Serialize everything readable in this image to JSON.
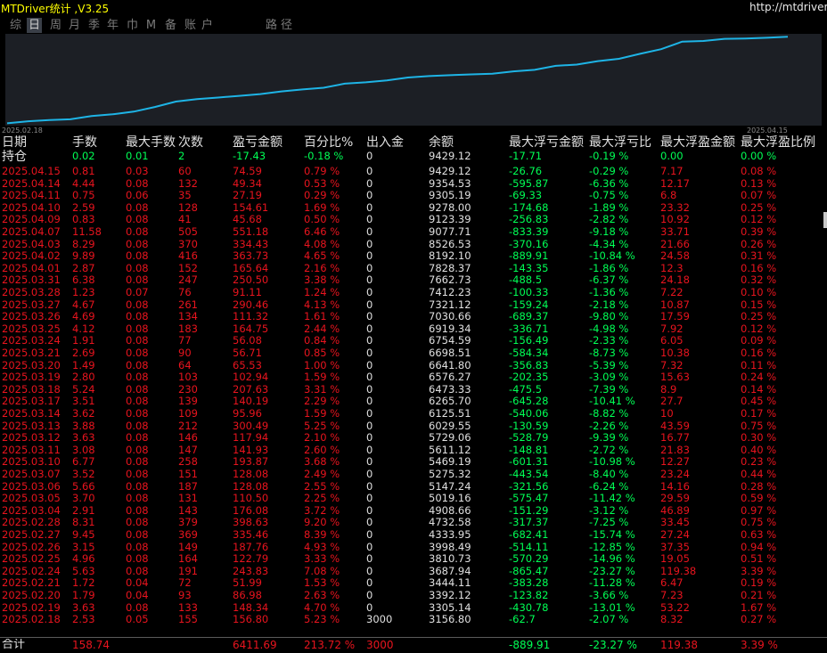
{
  "titlebar": {
    "title": "MTDriver统计 ,V3.25",
    "url": "http://mtdriver.c"
  },
  "tabs": [
    {
      "label": "综",
      "active": false
    },
    {
      "label": "日",
      "active": true
    },
    {
      "label": "周",
      "active": false
    },
    {
      "label": "月",
      "active": false
    },
    {
      "label": "季",
      "active": false
    },
    {
      "label": "年",
      "active": false
    },
    {
      "label": "巾",
      "active": false
    },
    {
      "label": "M",
      "active": false
    },
    {
      "label": "备",
      "active": false
    },
    {
      "label": "账",
      "active": false
    },
    {
      "label": "户",
      "active": false
    },
    {
      "label": "路",
      "active": false
    },
    {
      "label": "径",
      "active": false
    }
  ],
  "chart_data": {
    "type": "line",
    "x_start_label": "2025.02.18",
    "x_end_label": "2025.04.15",
    "line_color": "#1eb4e6",
    "x": [
      "2025.02.18",
      "2025.02.19",
      "2025.02.20",
      "2025.02.21",
      "2025.02.24",
      "2025.02.25",
      "2025.02.26",
      "2025.02.27",
      "2025.02.28",
      "2025.03.04",
      "2025.03.05",
      "2025.03.06",
      "2025.03.07",
      "2025.03.10",
      "2025.03.11",
      "2025.03.12",
      "2025.03.13",
      "2025.03.14",
      "2025.03.17",
      "2025.03.18",
      "2025.03.19",
      "2025.03.20",
      "2025.03.21",
      "2025.03.24",
      "2025.03.25",
      "2025.03.26",
      "2025.03.27",
      "2025.03.28",
      "2025.03.31",
      "2025.04.01",
      "2025.04.02",
      "2025.04.03",
      "2025.04.07",
      "2025.04.09",
      "2025.04.10",
      "2025.04.11",
      "2025.04.14",
      "2025.04.15"
    ],
    "values": [
      3156.8,
      3305.14,
      3392.12,
      3444.11,
      3687.94,
      3810.73,
      3998.49,
      4333.95,
      4732.58,
      4908.66,
      5019.16,
      5147.24,
      5275.32,
      5469.19,
      5611.12,
      5729.06,
      6029.55,
      6125.51,
      6265.7,
      6473.33,
      6576.27,
      6641.8,
      6698.51,
      6754.59,
      6919.34,
      7030.66,
      7321.12,
      7412.23,
      7662.73,
      7828.37,
      8192.1,
      8526.53,
      9077.71,
      9123.39,
      9278.0,
      9305.19,
      9354.53,
      9429.12
    ]
  },
  "columns": [
    "日期",
    "手数",
    "最大手数",
    "次数",
    "盈亏金额",
    "百分比%",
    "出入金",
    "余额",
    "最大浮亏金额",
    "最大浮亏比",
    "最大浮盈金额",
    "最大浮盈比例"
  ],
  "current": {
    "date": "持仓",
    "lots": "0.02",
    "max_lots": "0.01",
    "count": "2",
    "pnl": "-17.43",
    "pct": "-0.18 %",
    "inout": "0",
    "balance": "9429.12",
    "max_loss": "-17.71",
    "max_loss_pct": "-0.19 %",
    "max_profit": "0.00",
    "max_profit_pct": "0.00 %"
  },
  "rows": [
    {
      "date": "2025.04.15",
      "lots": "0.81",
      "max_lots": "0.03",
      "count": "60",
      "pnl": "74.59",
      "pct": "0.79 %",
      "inout": "0",
      "balance": "9429.12",
      "max_loss": "-26.76",
      "max_loss_pct": "-0.29 %",
      "max_profit": "7.17",
      "max_profit_pct": "0.08 %"
    },
    {
      "date": "2025.04.14",
      "lots": "4.44",
      "max_lots": "0.08",
      "count": "132",
      "pnl": "49.34",
      "pct": "0.53 %",
      "inout": "0",
      "balance": "9354.53",
      "max_loss": "-595.87",
      "max_loss_pct": "-6.36 %",
      "max_profit": "12.17",
      "max_profit_pct": "0.13 %"
    },
    {
      "date": "2025.04.11",
      "lots": "0.75",
      "max_lots": "0.06",
      "count": "35",
      "pnl": "27.19",
      "pct": "0.29 %",
      "inout": "0",
      "balance": "9305.19",
      "max_loss": "-69.33",
      "max_loss_pct": "-0.75 %",
      "max_profit": "6.8",
      "max_profit_pct": "0.07 %"
    },
    {
      "date": "2025.04.10",
      "lots": "2.59",
      "max_lots": "0.08",
      "count": "128",
      "pnl": "154.61",
      "pct": "1.69 %",
      "inout": "0",
      "balance": "9278.00",
      "max_loss": "-174.68",
      "max_loss_pct": "-1.89 %",
      "max_profit": "23.32",
      "max_profit_pct": "0.25 %"
    },
    {
      "date": "2025.04.09",
      "lots": "0.83",
      "max_lots": "0.08",
      "count": "41",
      "pnl": "45.68",
      "pct": "0.50 %",
      "inout": "0",
      "balance": "9123.39",
      "max_loss": "-256.83",
      "max_loss_pct": "-2.82 %",
      "max_profit": "10.92",
      "max_profit_pct": "0.12 %"
    },
    {
      "date": "2025.04.07",
      "lots": "11.58",
      "max_lots": "0.08",
      "count": "505",
      "pnl": "551.18",
      "pct": "6.46 %",
      "inout": "0",
      "balance": "9077.71",
      "max_loss": "-833.39",
      "max_loss_pct": "-9.18 %",
      "max_profit": "33.71",
      "max_profit_pct": "0.39 %"
    },
    {
      "date": "2025.04.03",
      "lots": "8.29",
      "max_lots": "0.08",
      "count": "370",
      "pnl": "334.43",
      "pct": "4.08 %",
      "inout": "0",
      "balance": "8526.53",
      "max_loss": "-370.16",
      "max_loss_pct": "-4.34 %",
      "max_profit": "21.66",
      "max_profit_pct": "0.26 %"
    },
    {
      "date": "2025.04.02",
      "lots": "9.89",
      "max_lots": "0.08",
      "count": "416",
      "pnl": "363.73",
      "pct": "4.65 %",
      "inout": "0",
      "balance": "8192.10",
      "max_loss": "-889.91",
      "max_loss_pct": "-10.84 %",
      "max_profit": "24.58",
      "max_profit_pct": "0.31 %"
    },
    {
      "date": "2025.04.01",
      "lots": "2.87",
      "max_lots": "0.08",
      "count": "152",
      "pnl": "165.64",
      "pct": "2.16 %",
      "inout": "0",
      "balance": "7828.37",
      "max_loss": "-143.35",
      "max_loss_pct": "-1.86 %",
      "max_profit": "12.3",
      "max_profit_pct": "0.16 %"
    },
    {
      "date": "2025.03.31",
      "lots": "6.38",
      "max_lots": "0.08",
      "count": "247",
      "pnl": "250.50",
      "pct": "3.38 %",
      "inout": "0",
      "balance": "7662.73",
      "max_loss": "-488.5",
      "max_loss_pct": "-6.37 %",
      "max_profit": "24.18",
      "max_profit_pct": "0.32 %"
    },
    {
      "date": "2025.03.28",
      "lots": "1.23",
      "max_lots": "0.07",
      "count": "76",
      "pnl": "91.11",
      "pct": "1.24 %",
      "inout": "0",
      "balance": "7412.23",
      "max_loss": "-100.33",
      "max_loss_pct": "-1.36 %",
      "max_profit": "7.22",
      "max_profit_pct": "0.10 %"
    },
    {
      "date": "2025.03.27",
      "lots": "4.67",
      "max_lots": "0.08",
      "count": "261",
      "pnl": "290.46",
      "pct": "4.13 %",
      "inout": "0",
      "balance": "7321.12",
      "max_loss": "-159.24",
      "max_loss_pct": "-2.18 %",
      "max_profit": "10.87",
      "max_profit_pct": "0.15 %"
    },
    {
      "date": "2025.03.26",
      "lots": "4.69",
      "max_lots": "0.08",
      "count": "134",
      "pnl": "111.32",
      "pct": "1.61 %",
      "inout": "0",
      "balance": "7030.66",
      "max_loss": "-689.37",
      "max_loss_pct": "-9.80 %",
      "max_profit": "17.59",
      "max_profit_pct": "0.25 %"
    },
    {
      "date": "2025.03.25",
      "lots": "4.12",
      "max_lots": "0.08",
      "count": "183",
      "pnl": "164.75",
      "pct": "2.44 %",
      "inout": "0",
      "balance": "6919.34",
      "max_loss": "-336.71",
      "max_loss_pct": "-4.98 %",
      "max_profit": "7.92",
      "max_profit_pct": "0.12 %"
    },
    {
      "date": "2025.03.24",
      "lots": "1.91",
      "max_lots": "0.08",
      "count": "77",
      "pnl": "56.08",
      "pct": "0.84 %",
      "inout": "0",
      "balance": "6754.59",
      "max_loss": "-156.49",
      "max_loss_pct": "-2.33 %",
      "max_profit": "6.05",
      "max_profit_pct": "0.09 %"
    },
    {
      "date": "2025.03.21",
      "lots": "2.69",
      "max_lots": "0.08",
      "count": "90",
      "pnl": "56.71",
      "pct": "0.85 %",
      "inout": "0",
      "balance": "6698.51",
      "max_loss": "-584.34",
      "max_loss_pct": "-8.73 %",
      "max_profit": "10.38",
      "max_profit_pct": "0.16 %"
    },
    {
      "date": "2025.03.20",
      "lots": "1.49",
      "max_lots": "0.08",
      "count": "64",
      "pnl": "65.53",
      "pct": "1.00 %",
      "inout": "0",
      "balance": "6641.80",
      "max_loss": "-356.83",
      "max_loss_pct": "-5.39 %",
      "max_profit": "7.32",
      "max_profit_pct": "0.11 %"
    },
    {
      "date": "2025.03.19",
      "lots": "2.80",
      "max_lots": "0.08",
      "count": "103",
      "pnl": "102.94",
      "pct": "1.59 %",
      "inout": "0",
      "balance": "6576.27",
      "max_loss": "-202.35",
      "max_loss_pct": "-3.09 %",
      "max_profit": "15.63",
      "max_profit_pct": "0.24 %"
    },
    {
      "date": "2025.03.18",
      "lots": "5.24",
      "max_lots": "0.08",
      "count": "230",
      "pnl": "207.63",
      "pct": "3.31 %",
      "inout": "0",
      "balance": "6473.33",
      "max_loss": "-475.5",
      "max_loss_pct": "-7.39 %",
      "max_profit": "8.9",
      "max_profit_pct": "0.14 %"
    },
    {
      "date": "2025.03.17",
      "lots": "3.51",
      "max_lots": "0.08",
      "count": "139",
      "pnl": "140.19",
      "pct": "2.29 %",
      "inout": "0",
      "balance": "6265.70",
      "max_loss": "-645.28",
      "max_loss_pct": "-10.41 %",
      "max_profit": "27.7",
      "max_profit_pct": "0.45 %"
    },
    {
      "date": "2025.03.14",
      "lots": "3.62",
      "max_lots": "0.08",
      "count": "109",
      "pnl": "95.96",
      "pct": "1.59 %",
      "inout": "0",
      "balance": "6125.51",
      "max_loss": "-540.06",
      "max_loss_pct": "-8.82 %",
      "max_profit": "10",
      "max_profit_pct": "0.17 %"
    },
    {
      "date": "2025.03.13",
      "lots": "3.88",
      "max_lots": "0.08",
      "count": "212",
      "pnl": "300.49",
      "pct": "5.25 %",
      "inout": "0",
      "balance": "6029.55",
      "max_loss": "-130.59",
      "max_loss_pct": "-2.26 %",
      "max_profit": "43.59",
      "max_profit_pct": "0.75 %"
    },
    {
      "date": "2025.03.12",
      "lots": "3.63",
      "max_lots": "0.08",
      "count": "146",
      "pnl": "117.94",
      "pct": "2.10 %",
      "inout": "0",
      "balance": "5729.06",
      "max_loss": "-528.79",
      "max_loss_pct": "-9.39 %",
      "max_profit": "16.77",
      "max_profit_pct": "0.30 %"
    },
    {
      "date": "2025.03.11",
      "lots": "3.08",
      "max_lots": "0.08",
      "count": "147",
      "pnl": "141.93",
      "pct": "2.60 %",
      "inout": "0",
      "balance": "5611.12",
      "max_loss": "-148.81",
      "max_loss_pct": "-2.72 %",
      "max_profit": "21.83",
      "max_profit_pct": "0.40 %"
    },
    {
      "date": "2025.03.10",
      "lots": "6.77",
      "max_lots": "0.08",
      "count": "258",
      "pnl": "193.87",
      "pct": "3.68 %",
      "inout": "0",
      "balance": "5469.19",
      "max_loss": "-601.31",
      "max_loss_pct": "-10.98 %",
      "max_profit": "12.27",
      "max_profit_pct": "0.23 %"
    },
    {
      "date": "2025.03.07",
      "lots": "3.52",
      "max_lots": "0.08",
      "count": "151",
      "pnl": "128.08",
      "pct": "2.49 %",
      "inout": "0",
      "balance": "5275.32",
      "max_loss": "-443.54",
      "max_loss_pct": "-8.40 %",
      "max_profit": "23.24",
      "max_profit_pct": "0.44 %"
    },
    {
      "date": "2025.03.06",
      "lots": "5.66",
      "max_lots": "0.08",
      "count": "187",
      "pnl": "128.08",
      "pct": "2.55 %",
      "inout": "0",
      "balance": "5147.24",
      "max_loss": "-321.56",
      "max_loss_pct": "-6.24 %",
      "max_profit": "14.16",
      "max_profit_pct": "0.28 %"
    },
    {
      "date": "2025.03.05",
      "lots": "3.70",
      "max_lots": "0.08",
      "count": "131",
      "pnl": "110.50",
      "pct": "2.25 %",
      "inout": "0",
      "balance": "5019.16",
      "max_loss": "-575.47",
      "max_loss_pct": "-11.42 %",
      "max_profit": "29.59",
      "max_profit_pct": "0.59 %"
    },
    {
      "date": "2025.03.04",
      "lots": "2.91",
      "max_lots": "0.08",
      "count": "143",
      "pnl": "176.08",
      "pct": "3.72 %",
      "inout": "0",
      "balance": "4908.66",
      "max_loss": "-151.29",
      "max_loss_pct": "-3.12 %",
      "max_profit": "46.89",
      "max_profit_pct": "0.97 %"
    },
    {
      "date": "2025.02.28",
      "lots": "8.31",
      "max_lots": "0.08",
      "count": "379",
      "pnl": "398.63",
      "pct": "9.20 %",
      "inout": "0",
      "balance": "4732.58",
      "max_loss": "-317.37",
      "max_loss_pct": "-7.25 %",
      "max_profit": "33.45",
      "max_profit_pct": "0.75 %"
    },
    {
      "date": "2025.02.27",
      "lots": "9.45",
      "max_lots": "0.08",
      "count": "369",
      "pnl": "335.46",
      "pct": "8.39 %",
      "inout": "0",
      "balance": "4333.95",
      "max_loss": "-682.41",
      "max_loss_pct": "-15.74 %",
      "max_profit": "27.24",
      "max_profit_pct": "0.63 %"
    },
    {
      "date": "2025.02.26",
      "lots": "3.15",
      "max_lots": "0.08",
      "count": "149",
      "pnl": "187.76",
      "pct": "4.93 %",
      "inout": "0",
      "balance": "3998.49",
      "max_loss": "-514.11",
      "max_loss_pct": "-12.85 %",
      "max_profit": "37.35",
      "max_profit_pct": "0.94 %"
    },
    {
      "date": "2025.02.25",
      "lots": "4.96",
      "max_lots": "0.08",
      "count": "164",
      "pnl": "122.79",
      "pct": "3.33 %",
      "inout": "0",
      "balance": "3810.73",
      "max_loss": "-570.29",
      "max_loss_pct": "-14.96 %",
      "max_profit": "19.05",
      "max_profit_pct": "0.51 %"
    },
    {
      "date": "2025.02.24",
      "lots": "5.63",
      "max_lots": "0.08",
      "count": "191",
      "pnl": "243.83",
      "pct": "7.08 %",
      "inout": "0",
      "balance": "3687.94",
      "max_loss": "-865.47",
      "max_loss_pct": "-23.27 %",
      "max_profit": "119.38",
      "max_profit_pct": "3.39 %"
    },
    {
      "date": "2025.02.21",
      "lots": "1.72",
      "max_lots": "0.04",
      "count": "72",
      "pnl": "51.99",
      "pct": "1.53 %",
      "inout": "0",
      "balance": "3444.11",
      "max_loss": "-383.28",
      "max_loss_pct": "-11.28 %",
      "max_profit": "6.47",
      "max_profit_pct": "0.19 %"
    },
    {
      "date": "2025.02.20",
      "lots": "1.79",
      "max_lots": "0.04",
      "count": "93",
      "pnl": "86.98",
      "pct": "2.63 %",
      "inout": "0",
      "balance": "3392.12",
      "max_loss": "-123.82",
      "max_loss_pct": "-3.66 %",
      "max_profit": "7.23",
      "max_profit_pct": "0.21 %"
    },
    {
      "date": "2025.02.19",
      "lots": "3.63",
      "max_lots": "0.08",
      "count": "133",
      "pnl": "148.34",
      "pct": "4.70 %",
      "inout": "0",
      "balance": "3305.14",
      "max_loss": "-430.78",
      "max_loss_pct": "-13.01 %",
      "max_profit": "53.22",
      "max_profit_pct": "1.67 %"
    },
    {
      "date": "2025.02.18",
      "lots": "2.53",
      "max_lots": "0.05",
      "count": "155",
      "pnl": "156.80",
      "pct": "5.23 %",
      "inout": "3000",
      "balance": "3156.80",
      "max_loss": "-62.7",
      "max_loss_pct": "-2.07 %",
      "max_profit": "8.32",
      "max_profit_pct": "0.27 %"
    }
  ],
  "totals": {
    "date": "合计",
    "lots": "158.74",
    "max_lots": "",
    "count": "",
    "pnl": "6411.69",
    "pct": "213.72 %",
    "inout": "3000",
    "balance": "",
    "max_loss": "-889.91",
    "max_loss_pct": "-23.27 %",
    "max_profit": "119.38",
    "max_profit_pct": "3.39 %"
  },
  "colors": {
    "loss": "#00ff55",
    "profit": "#e8141e",
    "neutral": "#e0e0e0",
    "title": "#ffff00",
    "chart_bg": "#1c1f25"
  }
}
